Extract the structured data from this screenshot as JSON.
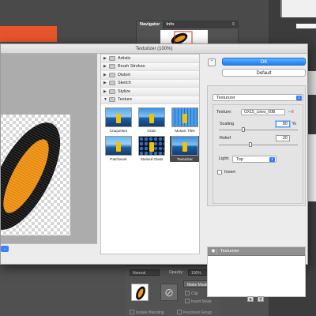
{
  "dialog": {
    "title": "Texturizer (100%)",
    "ok_label": "OK",
    "default_label": "Default",
    "zoom_value": "⌄"
  },
  "background_app": {
    "navigator_tabs": [
      "Navigator",
      "Info"
    ],
    "layers": {
      "blend_mode": "Normal",
      "opacity_label": "Opacity:",
      "opacity_value": "100%",
      "make_mask_label": "Make Mask",
      "clip_label": "Clip",
      "invert_mask_label": "Invert Mask",
      "isolate_blending_label": "Isolate Blending",
      "knockout_group_label": "Knockout Group"
    }
  },
  "filter_categories": [
    {
      "label": "Artistic",
      "expanded": false
    },
    {
      "label": "Brush Strokes",
      "expanded": false
    },
    {
      "label": "Distort",
      "expanded": false
    },
    {
      "label": "Sketch",
      "expanded": false
    },
    {
      "label": "Stylize",
      "expanded": false
    },
    {
      "label": "Texture",
      "expanded": true
    }
  ],
  "texture_filters": [
    {
      "label": "Craquelure",
      "style": "craq",
      "selected": false
    },
    {
      "label": "Grain",
      "style": "",
      "selected": false
    },
    {
      "label": "Mosaic Tiles",
      "style": "mosaic",
      "selected": false
    },
    {
      "label": "Patchwork",
      "style": "patch",
      "selected": false
    },
    {
      "label": "Stained Glass",
      "style": "stained",
      "selected": false
    },
    {
      "label": "Texturizer",
      "style": "",
      "selected": true
    }
  ],
  "settings": {
    "selected_filter": "Texturizer",
    "texture_label": "Texture:",
    "texture_value": "OX15_Lines_00B",
    "scaling_label": "Scaling",
    "scaling_value": "80",
    "scaling_unit": "%",
    "scaling_fraction": 0.3,
    "relief_label": "Relief",
    "relief_value": "20",
    "relief_fraction": 0.4,
    "light_label": "Light:",
    "light_value": "Top",
    "invert_label": "Invert",
    "invert_checked": false
  },
  "effect_layers": [
    {
      "label": "Texturizer",
      "visible": true
    }
  ],
  "colors": {
    "accent": "#1d7ff0",
    "artwork_orange": "#f39a1e",
    "artwork_black": "#111111"
  }
}
